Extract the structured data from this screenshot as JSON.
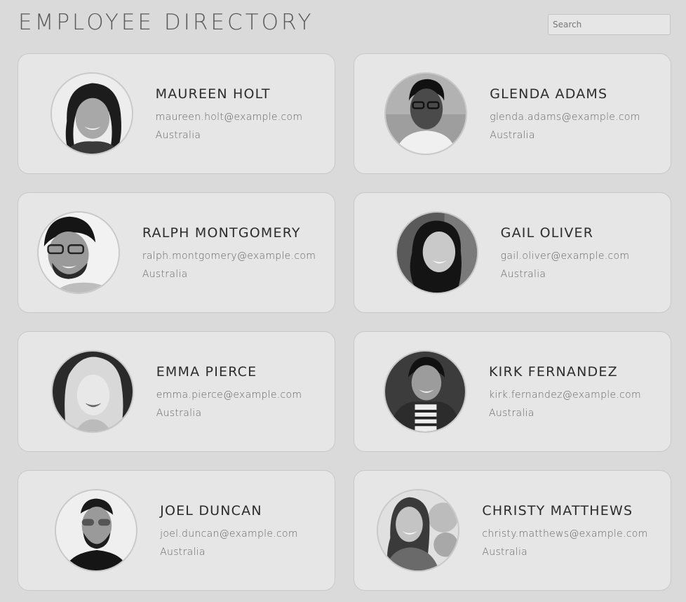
{
  "header": {
    "title": "EMPLOYEE DIRECTORY",
    "search_placeholder": "Search"
  },
  "employees": [
    {
      "name": "MAUREEN HOLT",
      "email": "maureen.holt@example.com",
      "location": "Australia",
      "avatar_icon": "person-photo-woman-dark-hair"
    },
    {
      "name": "GLENDA ADAMS",
      "email": "glenda.adams@example.com",
      "location": "Australia",
      "avatar_icon": "person-photo-woman-glasses"
    },
    {
      "name": "RALPH MONTGOMERY",
      "email": "ralph.montgomery@example.com",
      "location": "Australia",
      "avatar_icon": "person-photo-man-glasses-beard"
    },
    {
      "name": "GAIL OLIVER",
      "email": "gail.oliver@example.com",
      "location": "Australia",
      "avatar_icon": "person-photo-woman-dark-hair"
    },
    {
      "name": "EMMA PIERCE",
      "email": "emma.pierce@example.com",
      "location": "Australia",
      "avatar_icon": "person-photo-woman-blonde"
    },
    {
      "name": "KIRK FERNANDEZ",
      "email": "kirk.fernandez@example.com",
      "location": "Australia",
      "avatar_icon": "person-photo-man-striped-shirt"
    },
    {
      "name": "JOEL DUNCAN",
      "email": "joel.duncan@example.com",
      "location": "Australia",
      "avatar_icon": "person-photo-man-sunglasses"
    },
    {
      "name": "CHRISTY MATTHEWS",
      "email": "christy.matthews@example.com",
      "location": "Australia",
      "avatar_icon": "person-photo-woman-outdoors"
    }
  ]
}
